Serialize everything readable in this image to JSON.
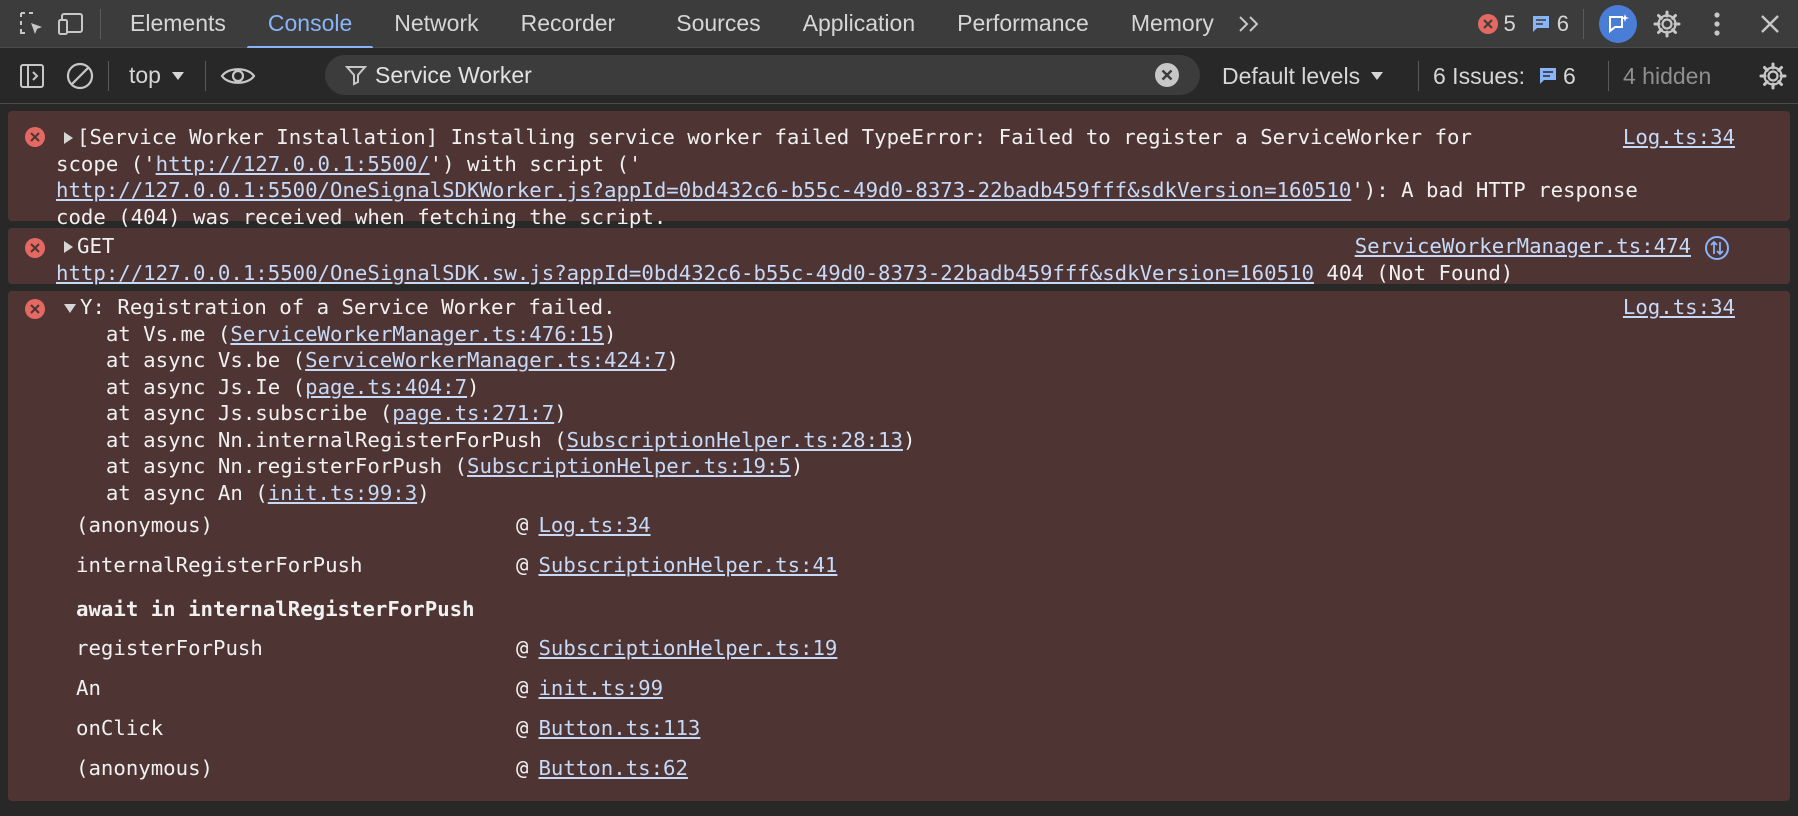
{
  "tabs": [
    "Elements",
    "Console",
    "Network",
    "Recorder",
    "Sources",
    "Application",
    "Performance",
    "Memory"
  ],
  "active_tab": "Console",
  "status": {
    "errors": "5",
    "messages": "6"
  },
  "toolbar": {
    "context": "top",
    "filter_value": "Service Worker",
    "levels": "Default levels",
    "issues_label": "6 Issues:",
    "issues_count": "6",
    "hidden": "4 hidden"
  },
  "messages": [
    {
      "source": "Log.ts:34",
      "t1": "[Service Worker Installation] Installing service worker failed TypeError: Failed to register a ServiceWorker for",
      "t2_pre": "scope ('",
      "t2_link": "http://127.0.0.1:5500/",
      "t2_post": "') with script ('",
      "t3_link": "http://127.0.0.1:5500/OneSignalSDKWorker.js?appId=0bd432c6-b55c-49d0-8373-22badb459fff&sdkVersion=160510",
      "t3_post": "'): A bad HTTP response",
      "t4": "code (404) was received when fetching the script."
    },
    {
      "source": "ServiceWorkerManager.ts:474",
      "t1": "GET",
      "t2_link": "http://127.0.0.1:5500/OneSignalSDK.sw.js?appId=0bd432c6-b55c-49d0-8373-22badb459fff&sdkVersion=160510",
      "t2_post": " 404 (Not Found)"
    },
    {
      "source": "Log.ts:34",
      "t1": "Y: Registration of a Service Worker failed.",
      "stack": [
        {
          "pre": "    at Vs.me (",
          "link": "ServiceWorkerManager.ts:476:15",
          "post": ")"
        },
        {
          "pre": "    at async Vs.be (",
          "link": "ServiceWorkerManager.ts:424:7",
          "post": ")"
        },
        {
          "pre": "    at async Js.Ie (",
          "link": "page.ts:404:7",
          "post": ")"
        },
        {
          "pre": "    at async Js.subscribe (",
          "link": "page.ts:271:7",
          "post": ")"
        },
        {
          "pre": "    at async Nn.internalRegisterForPush (",
          "link": "SubscriptionHelper.ts:28:13",
          "post": ")"
        },
        {
          "pre": "    at async Nn.registerForPush (",
          "link": "SubscriptionHelper.ts:19:5",
          "post": ")"
        },
        {
          "pre": "    at async An (",
          "link": "init.ts:99:3",
          "post": ")"
        }
      ],
      "call_stack": [
        {
          "fn": "(anonymous)",
          "at": "@",
          "loc": "Log.ts:34"
        },
        {
          "fn": "internalRegisterForPush",
          "at": "@",
          "loc": "SubscriptionHelper.ts:41"
        },
        {
          "fn": "await in internalRegisterForPush"
        },
        {
          "fn": "registerForPush",
          "at": "@",
          "loc": "SubscriptionHelper.ts:19"
        },
        {
          "fn": "An",
          "at": "@",
          "loc": "init.ts:99"
        },
        {
          "fn": "onClick",
          "at": "@",
          "loc": "Button.ts:113"
        },
        {
          "fn": "(anonymous)",
          "at": "@",
          "loc": "Button.ts:62"
        }
      ]
    }
  ],
  "colors": {
    "panel_bg": "#282828",
    "error_bg": "#4e3534",
    "error_icon": "#e46962",
    "link": "#c6d9f7",
    "accent": "#8ab4f8"
  },
  "icons": [
    "inspect-icon",
    "device-toggle-icon",
    "more-tabs-icon",
    "error-icon",
    "message-icon",
    "ai-assist-icon",
    "gear-icon",
    "more-vert-icon",
    "close-icon",
    "sidebar-icon",
    "clear-icon",
    "eye-icon",
    "filter-icon",
    "clear-input-icon",
    "network-request-icon"
  ]
}
